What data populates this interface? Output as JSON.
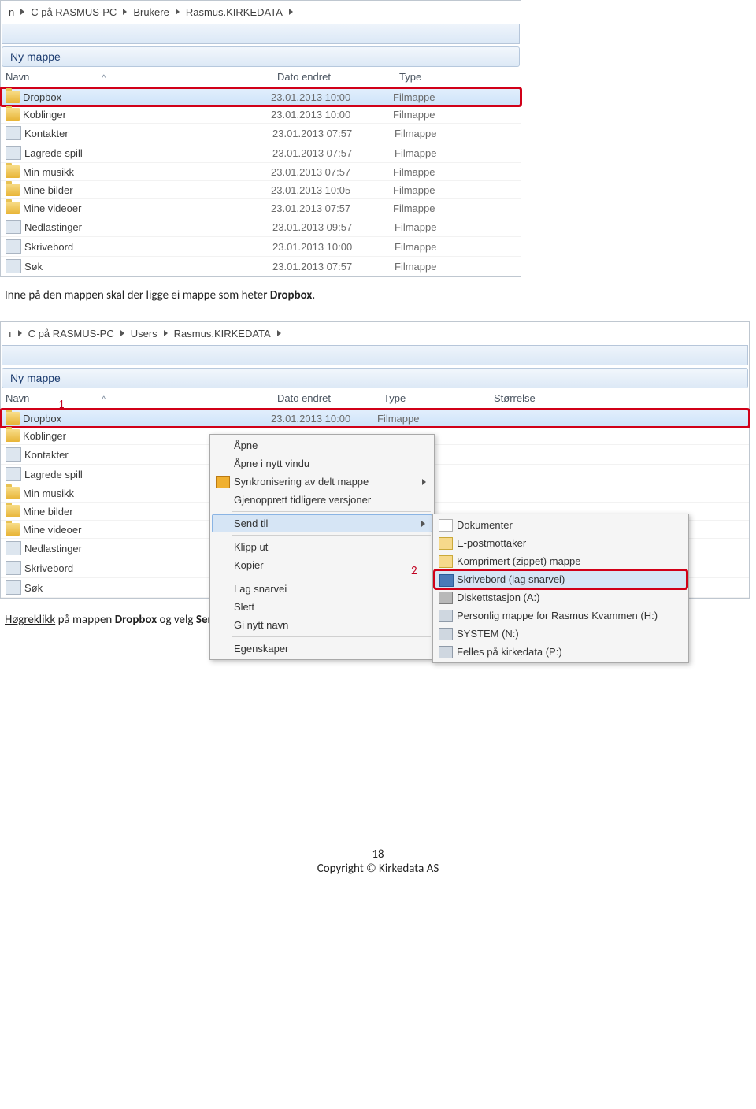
{
  "explorer1": {
    "breadcrumbs": [
      "n",
      "C på RASMUS-PC",
      "Brukere",
      "Rasmus.KIRKEDATA"
    ],
    "new_folder": "Ny mappe",
    "headers": {
      "name": "Navn",
      "date": "Dato endret",
      "type": "Type"
    },
    "rows": [
      {
        "name": "Dropbox",
        "date": "23.01.2013 10:00",
        "type": "Filmappe",
        "sel": true
      },
      {
        "name": "Koblinger",
        "date": "23.01.2013 10:00",
        "type": "Filmappe"
      },
      {
        "name": "Kontakter",
        "date": "23.01.2013 07:57",
        "type": "Filmappe"
      },
      {
        "name": "Lagrede spill",
        "date": "23.01.2013 07:57",
        "type": "Filmappe"
      },
      {
        "name": "Min musikk",
        "date": "23.01.2013 07:57",
        "type": "Filmappe"
      },
      {
        "name": "Mine bilder",
        "date": "23.01.2013 10:05",
        "type": "Filmappe"
      },
      {
        "name": "Mine videoer",
        "date": "23.01.2013 07:57",
        "type": "Filmappe"
      },
      {
        "name": "Nedlastinger",
        "date": "23.01.2013 09:57",
        "type": "Filmappe"
      },
      {
        "name": "Skrivebord",
        "date": "23.01.2013 10:00",
        "type": "Filmappe"
      },
      {
        "name": "Søk",
        "date": "23.01.2013 07:57",
        "type": "Filmappe"
      }
    ]
  },
  "caption1_parts": {
    "t1": "Inne på den mappen skal der ligge ei mappe som heter ",
    "b": "Dropbox",
    "t2": "."
  },
  "explorer2": {
    "breadcrumbs": [
      "ı",
      "C på RASMUS-PC",
      "Users",
      "Rasmus.KIRKEDATA"
    ],
    "new_folder": "Ny mappe",
    "headers": {
      "name": "Navn",
      "date": "Dato endret",
      "type": "Type",
      "size": "Størrelse"
    },
    "rows": [
      {
        "name": "Dropbox",
        "date": "23.01.2013 10:00",
        "type": "Filmappe",
        "sel": true
      },
      {
        "name": "Koblinger",
        "date": "",
        "type": ""
      },
      {
        "name": "Kontakter",
        "date": "",
        "type": ""
      },
      {
        "name": "Lagrede spill",
        "date": "",
        "type": ""
      },
      {
        "name": "Min musikk",
        "date": "",
        "type": ""
      },
      {
        "name": "Mine bilder",
        "date": "",
        "type": ""
      },
      {
        "name": "Mine videoer",
        "date": "",
        "type": ""
      },
      {
        "name": "Nedlastinger",
        "date": "",
        "type": ""
      },
      {
        "name": "Skrivebord",
        "date": "",
        "type": ""
      },
      {
        "name": "Søk",
        "date": "",
        "type": ""
      }
    ]
  },
  "annotation": {
    "one": "1",
    "two": "2"
  },
  "context_menu": {
    "items": [
      "Åpne",
      "Åpne i nytt vindu",
      "Synkronisering av delt mappe",
      "Gjenopprett tidligere versjoner"
    ],
    "send_to": "Send til",
    "items2": [
      "Klipp ut",
      "Kopier"
    ],
    "items3": [
      "Lag snarvei",
      "Slett",
      "Gi nytt navn"
    ],
    "items4": [
      "Egenskaper"
    ]
  },
  "submenu": {
    "items_top": [
      "Dokumenter",
      "E-postmottaker",
      "Komprimert (zippet) mappe"
    ],
    "highlight": "Skrivebord (lag snarvei)",
    "items_bot": [
      "Diskettstasjon (A:)",
      "Personlig mappe for Rasmus Kvammen (H:)",
      "SYSTEM (N:)",
      "Felles på kirkedata (P:)"
    ]
  },
  "caption2_parts": {
    "u": "Høgreklikk",
    "t1": " på mappen ",
    "b1": "Dropbox",
    "t2": " og velg ",
    "b2": "Send til -> Skrivebord (lag snarvei)"
  },
  "footer": {
    "page": "18",
    "copy": "Copyright © Kirkedata AS"
  }
}
